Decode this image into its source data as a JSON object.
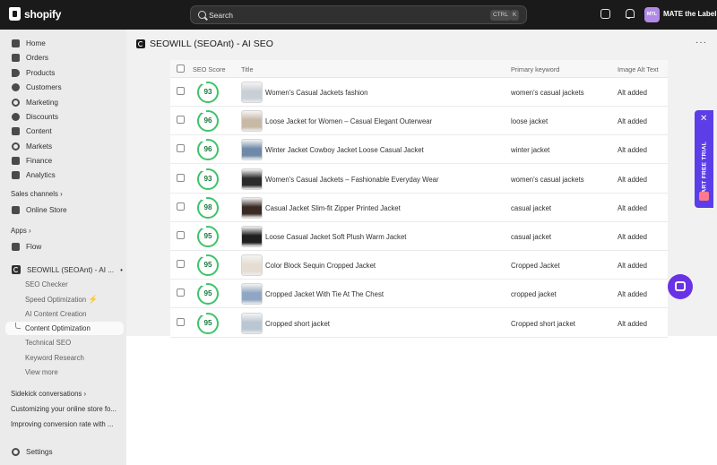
{
  "topbar": {
    "logo_text": "shopify",
    "search_placeholder": "Search",
    "shortcut_keys": [
      "CTRL",
      "K"
    ],
    "avatar_initials": "MTL",
    "store_name": "MATE the Label"
  },
  "sidebar": {
    "items": [
      {
        "label": "Home",
        "icon": "home-icon"
      },
      {
        "label": "Orders",
        "icon": "orders-icon"
      },
      {
        "label": "Products",
        "icon": "tag-icon"
      },
      {
        "label": "Customers",
        "icon": "person-icon"
      },
      {
        "label": "Marketing",
        "icon": "target-icon"
      },
      {
        "label": "Discounts",
        "icon": "discount-icon"
      },
      {
        "label": "Content",
        "icon": "content-icon"
      },
      {
        "label": "Markets",
        "icon": "globe-icon"
      },
      {
        "label": "Finance",
        "icon": "bank-icon"
      },
      {
        "label": "Analytics",
        "icon": "chart-icon"
      }
    ],
    "sales_channels_label": "Sales channels",
    "sales_channels": [
      {
        "label": "Online Store",
        "icon": "storefront-icon"
      }
    ],
    "apps_label": "Apps",
    "apps": [
      {
        "label": "Flow",
        "icon": "flow-icon"
      }
    ],
    "app_name": "SEOWILL (SEOAnt) - AI ...",
    "app_subitems": [
      {
        "label": "SEO Checker"
      },
      {
        "label": "Speed Optimization"
      },
      {
        "label": "AI Content Creation"
      },
      {
        "label": "Content Optimization",
        "active": true
      },
      {
        "label": "Technical SEO"
      },
      {
        "label": "Keyword Research"
      },
      {
        "label": "View more"
      }
    ],
    "sidekick_label": "Sidekick conversations",
    "sidekick": [
      {
        "label": "Customizing your online store fo..."
      },
      {
        "label": "Improving conversion rate with ..."
      }
    ],
    "settings_label": "Settings"
  },
  "page": {
    "title": "SEOWILL (SEOAnt) - AI SEO",
    "more_label": "···"
  },
  "table": {
    "columns": [
      "SEO Score",
      "Title",
      "Primary keyword",
      "Image Alt Text"
    ],
    "rows": [
      {
        "score": "93",
        "title": "Women's Casual Jackets fashion",
        "keyword": "women's casual jackets",
        "alt": "Alt added",
        "thumb_color": "#c9cfd6"
      },
      {
        "score": "96",
        "title": "Loose Jacket for Women – Casual Elegant Outerwear",
        "keyword": "loose jacket",
        "alt": "Alt added",
        "thumb_color": "#c8b8a6"
      },
      {
        "score": "96",
        "title": "Winter Jacket Cowboy Jacket Loose Casual Jacket",
        "keyword": "winter jacket",
        "alt": "Alt added",
        "thumb_color": "#6f8aa8"
      },
      {
        "score": "93",
        "title": "Women's Casual Jackets – Fashionable Everyday Wear",
        "keyword": "women's casual jackets",
        "alt": "Alt added",
        "thumb_color": "#2b2b2b"
      },
      {
        "score": "98",
        "title": "Casual Jacket Slim-fit Zipper Printed Jacket",
        "keyword": "casual jacket",
        "alt": "Alt added",
        "thumb_color": "#3a2a24"
      },
      {
        "score": "95",
        "title": "Loose Casual Jacket Soft Plush Warm Jacket",
        "keyword": "casual jacket",
        "alt": "Alt added",
        "thumb_color": "#1f1f1f"
      },
      {
        "score": "95",
        "title": "Color Block Sequin Cropped Jacket",
        "keyword": "Cropped Jacket",
        "alt": "Alt added",
        "thumb_color": "#e6ddd2"
      },
      {
        "score": "95",
        "title": "Cropped Jacket With Tie At The Chest",
        "keyword": "cropped jacket",
        "alt": "Alt added",
        "thumb_color": "#8fa7c4"
      },
      {
        "score": "95",
        "title": "Cropped short jacket",
        "keyword": "Cropped short jacket",
        "alt": "Alt added",
        "thumb_color": "#b9c6d3"
      }
    ]
  },
  "widgets": {
    "trial_label": "START FREE TRIAL",
    "trial_close": "✕"
  },
  "colors": {
    "topbar": "#1a1a1a",
    "sidebar": "#ebebeb",
    "score_ring": "#3ec36a",
    "trial": "#5b3ee8",
    "chat": "#6a32e6"
  }
}
